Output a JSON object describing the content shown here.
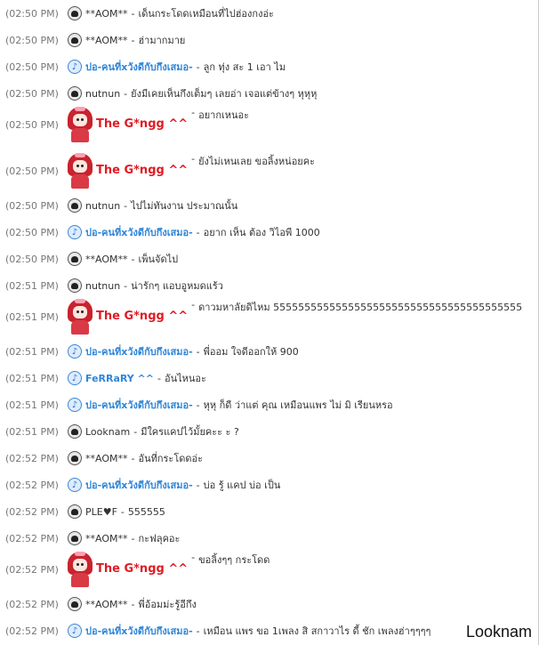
{
  "rows": [
    {
      "time": "(02:50 PM)",
      "nick": "**AOM**",
      "msg": "เด็นกระโดดเหมือนที่ไปฮ่องกงอ่ะ"
    },
    {
      "time": "(02:50 PM)",
      "nick": "**AOM**",
      "msg": "ฮ่ามากมาย"
    },
    {
      "time": "(02:50 PM)",
      "nick": "ปอ-คนที่xวังดีกับกึงเสมอ-",
      "msg": "ลูก ทุ่ง สะ 1 เอา ไม"
    },
    {
      "time": "(02:50 PM)",
      "nick": "nutnun",
      "msg": "ยังมีเคยเห็นกึงเต็มๆ เลยอ่า เจอแต่ข้างๆ หุหุหุ"
    },
    {
      "time": "(02:50 PM)",
      "nick": "The G*ngg ^^",
      "msg": "อยากเหนอะ"
    },
    {
      "time": "(02:50 PM)",
      "nick": "The G*ngg ^^",
      "msg": "ยังไม่เหนเลย ขอลิ้งหน่อยคะ"
    },
    {
      "time": "(02:50 PM)",
      "nick": "nutnun",
      "msg": "ไปไม่ทันงาน ประมาณนั้น"
    },
    {
      "time": "(02:50 PM)",
      "nick": "ปอ-คนที่xวังดีกับกึงเสมอ-",
      "msg": "อยาก เห็น ต้อง วิไอพี 1000"
    },
    {
      "time": "(02:50 PM)",
      "nick": "**AOM**",
      "msg": "เพ็นจัดไป"
    },
    {
      "time": "(02:51 PM)",
      "nick": "nutnun",
      "msg": "น่ารักๆ แอบอูหมดแร้ว"
    },
    {
      "time": "(02:51 PM)",
      "nick": "The G*ngg ^^",
      "msg": "ดาวมหาลัยดิไหม 5555555555555555555555555555555555555555"
    },
    {
      "time": "(02:51 PM)",
      "nick": "ปอ-คนที่xวังดีกับกึงเสมอ-",
      "msg": "พี่ออม ใจดีออกให้ 900"
    },
    {
      "time": "(02:51 PM)",
      "nick": "FeRRaRY ^^",
      "msg": "อันไหนอะ"
    },
    {
      "time": "(02:51 PM)",
      "nick": "ปอ-คนที่xวังดีกับกึงเสมอ-",
      "msg": "หุหุ ก็ดี ว่าแต่ คุณ เหมือนแพร ไม่ มิ เรียนหรอ"
    },
    {
      "time": "(02:51 PM)",
      "nick": "Looknam",
      "msg": "มีใครแคปไว้มั้ยคะะ ะ ?"
    },
    {
      "time": "(02:52 PM)",
      "nick": "**AOM**",
      "msg": "อันที่กระโดดอ่ะ"
    },
    {
      "time": "(02:52 PM)",
      "nick": "ปอ-คนที่xวังดีกับกึงเสมอ-",
      "msg": "บ่อ รู้ แคป บ่อ เป็น"
    },
    {
      "time": "(02:52 PM)",
      "nick": "PLE♥F",
      "msg": "555555"
    },
    {
      "time": "(02:52 PM)",
      "nick": "**AOM**",
      "msg": "กะฟลุคอะ"
    },
    {
      "time": "(02:52 PM)",
      "nick": "The G*ngg ^^",
      "msg": "ขอลิ้งๆๆ กระโดด"
    },
    {
      "time": "(02:52 PM)",
      "nick": "**AOM**",
      "msg": "พี่อ้อมม่ะรู้อีกึง"
    },
    {
      "time": "(02:52 PM)",
      "nick": "ปอ-คนที่xวังดีกับกึงเสมอ-",
      "msg": "เหมือน แพร ขอ 1เพลง สิ สกาวาไร ดี้ ชัก เพลงฮ่าๆๆๆๆ"
    }
  ],
  "separator": "-",
  "watermark": "Looknam"
}
